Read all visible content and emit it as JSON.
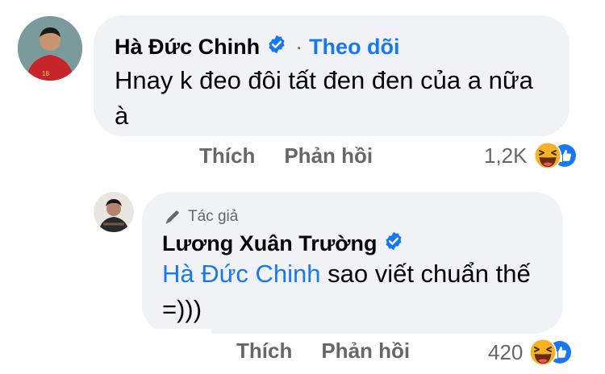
{
  "comment": {
    "author": "Hà Đức Chinh",
    "separator": "·",
    "follow_label": "Theo dõi",
    "text_line1": "Hnay k đeo đôi tất đen đen của a nữa",
    "text_line2": "à",
    "like_label": "Thích",
    "reply_label": "Phản hồi",
    "reaction_count": "1,2K",
    "avatar_number": "18"
  },
  "reply": {
    "author_tag": "Tác giả",
    "author": "Lương Xuân Trường",
    "mention": "Hà Đức Chinh",
    "text_rest": " sao viết chuẩn thế",
    "text_line2": "=)))",
    "like_label": "Thích",
    "reply_label": "Phản hồi",
    "reaction_count": "420"
  },
  "colors": {
    "bubble": "#f0f2f5",
    "link_blue": "#1877f2",
    "meta_gray": "#65676b",
    "haha_yellow": "#f7b125",
    "like_blue": "#1877f2"
  },
  "icons": [
    "verified-badge-icon",
    "haha-reaction-icon",
    "like-reaction-icon",
    "pen-icon"
  ]
}
